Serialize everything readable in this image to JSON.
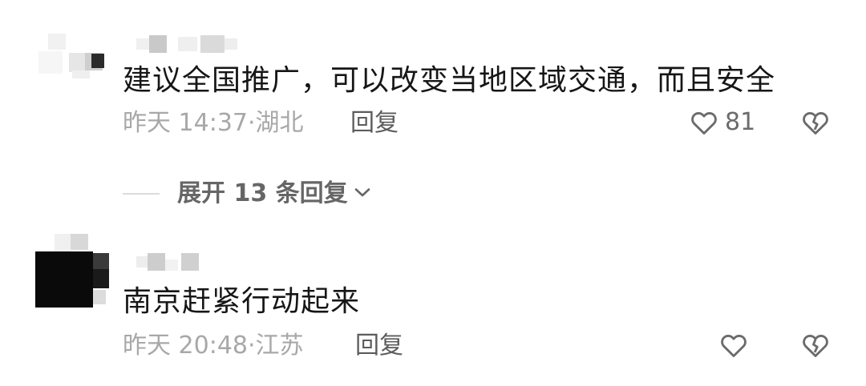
{
  "comments": [
    {
      "text": "建议全国推广，可以改变当地区域交通，而且安全",
      "time": "昨天 14:37·",
      "location": "湖北",
      "reply_label": "回复",
      "like_count": "81",
      "like_icon": "heart-outline-icon",
      "dislike_icon": "broken-heart-icon"
    },
    {
      "text": "南京赶紧行动起来",
      "time": "昨天 20:48·",
      "location": "江苏",
      "reply_label": "回复",
      "like_count": "",
      "like_icon": "heart-outline-icon",
      "dislike_icon": "broken-heart-icon"
    }
  ],
  "expand_replies": {
    "label": "展开 13 条回复",
    "icon": "chevron-down-icon"
  },
  "colors": {
    "text": "#161616",
    "meta": "#a8a8a8",
    "reply": "#5c5c5c",
    "icon": "#6b6b6b"
  }
}
